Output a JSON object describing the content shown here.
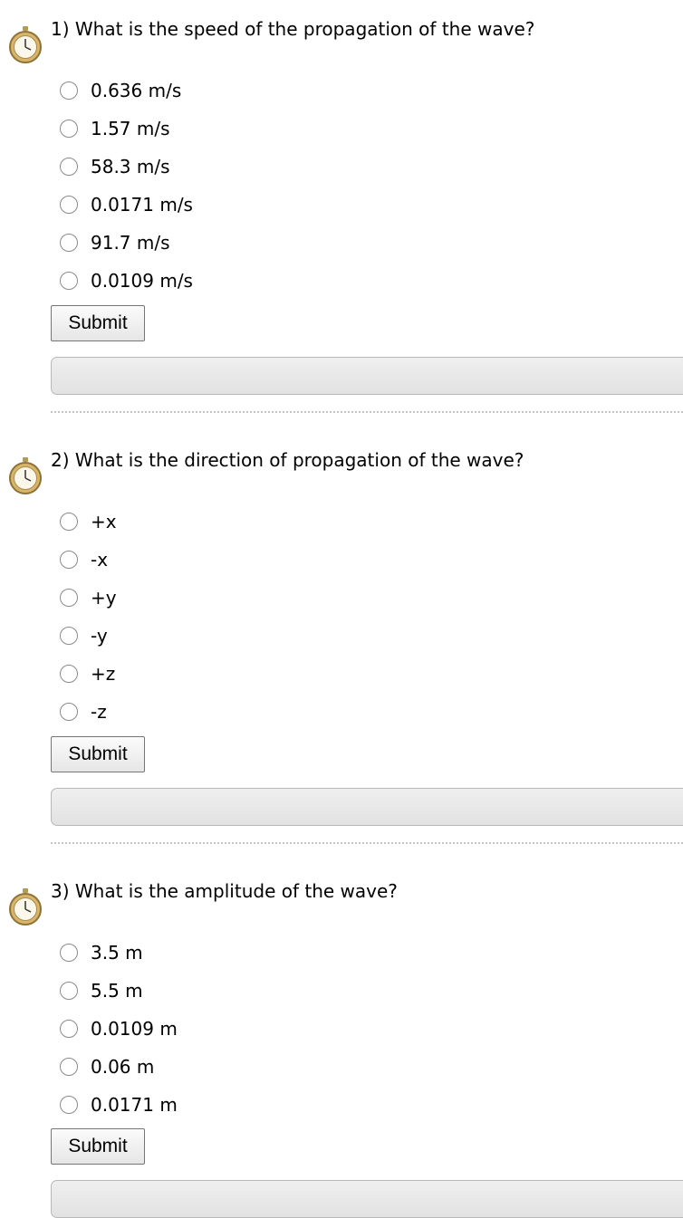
{
  "questions": [
    {
      "text": "1) What is the speed of the propagation of the wave?",
      "icon": "stopwatch-icon",
      "options": [
        "0.636 m/s",
        "1.57 m/s",
        "58.3 m/s",
        "0.0171 m/s",
        "91.7 m/s",
        "0.0109 m/s"
      ],
      "submit_label": "Submit"
    },
    {
      "text": "2) What is the direction of propagation of the wave?",
      "icon": "stopwatch-icon",
      "options": [
        "+x",
        "-x",
        "+y",
        "-y",
        "+z",
        "-z"
      ],
      "submit_label": "Submit"
    },
    {
      "text": "3) What is the amplitude of the wave?",
      "icon": "stopwatch-icon",
      "options": [
        "3.5 m",
        "5.5 m",
        "0.0109 m",
        "0.06 m",
        "0.0171 m"
      ],
      "submit_label": "Submit"
    }
  ]
}
